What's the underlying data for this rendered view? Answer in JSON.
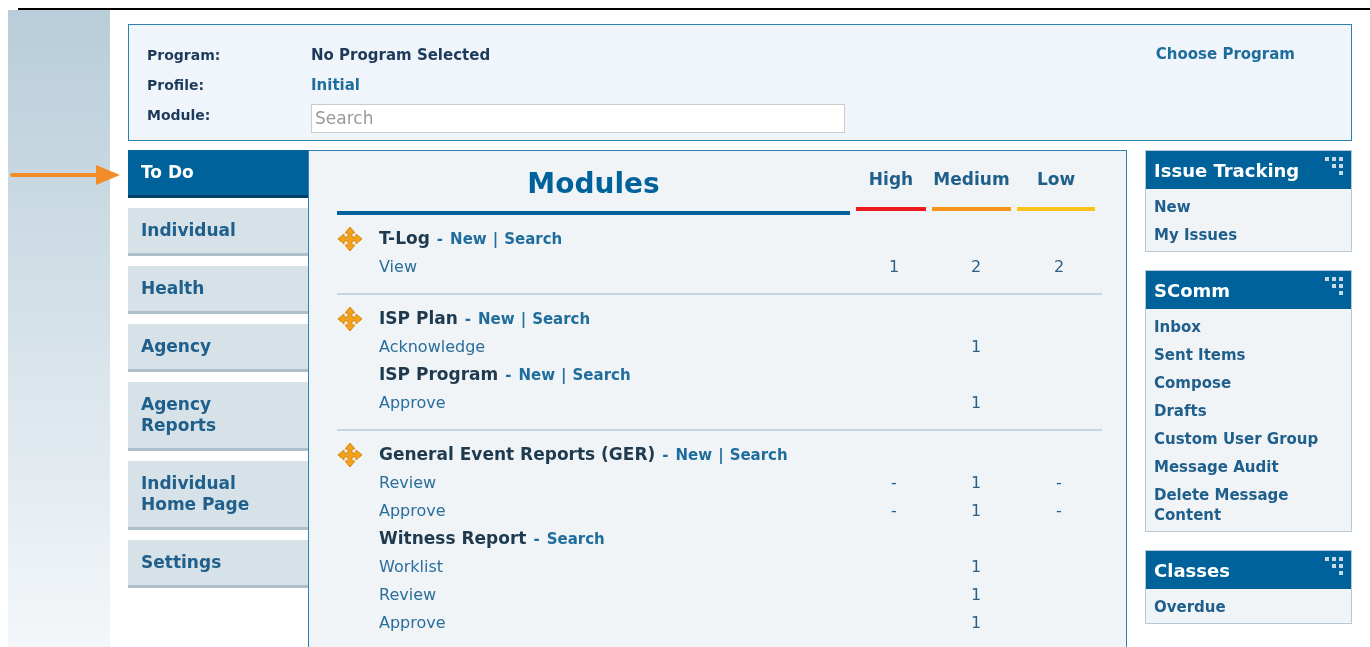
{
  "header": {
    "fields": [
      {
        "kind": "text",
        "label": "Program:",
        "value": "No Program Selected"
      },
      {
        "kind": "link",
        "label": "Profile:",
        "value": "Initial"
      },
      {
        "kind": "input",
        "label": "Module:",
        "placeholder": "Search"
      }
    ],
    "action": "Choose Program"
  },
  "nav": [
    {
      "label": "To Do",
      "selected": true
    },
    {
      "label": "Individual",
      "selected": false
    },
    {
      "label": "Health",
      "selected": false
    },
    {
      "label": "Agency",
      "selected": false
    },
    {
      "label": "Agency Reports",
      "selected": false
    },
    {
      "label": "Individual Home Page",
      "selected": false
    },
    {
      "label": "Settings",
      "selected": false
    }
  ],
  "modules": {
    "title": "Modules",
    "title_separator": "-",
    "link_separator": "|",
    "priorities": [
      {
        "label": "High",
        "color": "#ee1c1c"
      },
      {
        "label": "Medium",
        "color": "#f7941d"
      },
      {
        "label": "Low",
        "color": "#fcc419"
      }
    ],
    "groups": [
      {
        "entries": [
          {
            "title": "T-Log",
            "links": [
              "New",
              "Search"
            ],
            "actions": [
              {
                "label": "View",
                "counts": {
                  "high": "1",
                  "medium": "2",
                  "low": "2"
                }
              }
            ]
          }
        ]
      },
      {
        "entries": [
          {
            "title": "ISP Plan",
            "links": [
              "New",
              "Search"
            ],
            "actions": [
              {
                "label": "Acknowledge",
                "counts": {
                  "medium": "1"
                }
              }
            ]
          },
          {
            "title": "ISP Program",
            "links": [
              "New",
              "Search"
            ],
            "actions": [
              {
                "label": "Approve",
                "counts": {
                  "medium": "1"
                }
              }
            ]
          }
        ]
      },
      {
        "entries": [
          {
            "title": "General Event Reports (GER)",
            "links": [
              "New",
              "Search"
            ],
            "actions": [
              {
                "label": "Review",
                "counts": {
                  "high": "-",
                  "medium": "1",
                  "low": "-"
                }
              },
              {
                "label": "Approve",
                "counts": {
                  "high": "-",
                  "medium": "1",
                  "low": "-"
                }
              }
            ]
          },
          {
            "title": "Witness Report",
            "links": [
              "Search"
            ],
            "actions": [
              {
                "label": "Worklist",
                "counts": {
                  "medium": "1"
                }
              },
              {
                "label": "Review",
                "counts": {
                  "medium": "1"
                }
              },
              {
                "label": "Approve",
                "counts": {
                  "medium": "1"
                }
              }
            ]
          }
        ]
      }
    ]
  },
  "panels": [
    {
      "title": "Issue Tracking",
      "items": [
        "New",
        "My Issues"
      ]
    },
    {
      "title": "SComm",
      "items": [
        "Inbox",
        "Sent Items",
        "Compose",
        "Drafts",
        "Custom User Group",
        "Message Audit",
        "Delete Message Content"
      ]
    },
    {
      "title": "Classes",
      "items": [
        "Overdue"
      ]
    }
  ]
}
